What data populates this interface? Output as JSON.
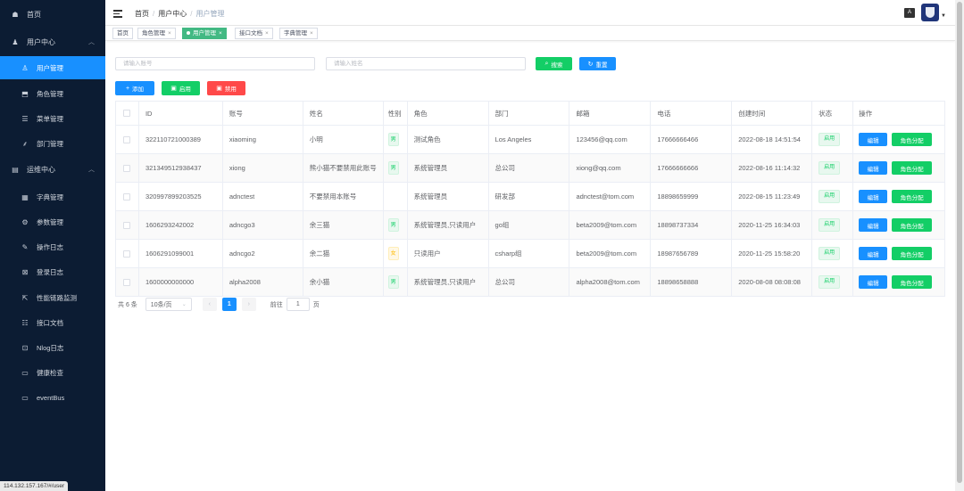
{
  "sidebar": {
    "items": [
      {
        "label": "首页",
        "icon": "dashboard-icon",
        "glyph": "☗"
      },
      {
        "label": "用户中心",
        "icon": "user-group-icon",
        "glyph": "♟"
      },
      {
        "label": "用户管理",
        "icon": "user-icon",
        "glyph": "♙"
      },
      {
        "label": "角色管理",
        "icon": "role-icon",
        "glyph": "⬒"
      },
      {
        "label": "菜单管理",
        "icon": "menu-list-icon",
        "glyph": "☰"
      },
      {
        "label": "部门管理",
        "icon": "tree-icon",
        "glyph": "⸙"
      },
      {
        "label": "运维中心",
        "icon": "ops-icon",
        "glyph": "▤"
      },
      {
        "label": "字典管理",
        "icon": "dict-icon",
        "glyph": "▦"
      },
      {
        "label": "参数管理",
        "icon": "param-icon",
        "glyph": "⚙"
      },
      {
        "label": "操作日志",
        "icon": "edit-log-icon",
        "glyph": "✎"
      },
      {
        "label": "登录日志",
        "icon": "login-log-icon",
        "glyph": "⊠"
      },
      {
        "label": "性能链路监测",
        "icon": "monitor-icon",
        "glyph": "⇱"
      },
      {
        "label": "接口文档",
        "icon": "api-doc-icon",
        "glyph": "☷"
      },
      {
        "label": "Nlog日志",
        "icon": "nlog-icon",
        "glyph": "⊡"
      },
      {
        "label": "健康检查",
        "icon": "health-icon",
        "glyph": "▭"
      },
      {
        "label": "eventBus",
        "icon": "eventbus-icon",
        "glyph": "▭"
      }
    ],
    "status_url": "114.132.157.167/#/user"
  },
  "header": {
    "breadcrumb": [
      "首页",
      "用户中心",
      "用户管理"
    ],
    "lang_label": "A"
  },
  "tags": [
    {
      "label": "首页"
    },
    {
      "label": "角色管理"
    },
    {
      "label": "用户管理"
    },
    {
      "label": "接口文档"
    },
    {
      "label": "字典管理"
    }
  ],
  "search": {
    "account_placeholder": "请输入账号",
    "name_placeholder": "请输入姓名",
    "search_label": "搜索",
    "reset_label": "重置"
  },
  "toolbar": {
    "add_label": "添加",
    "enable_label": "启用",
    "disable_label": "禁用"
  },
  "table": {
    "columns": [
      "ID",
      "账号",
      "姓名",
      "性别",
      "角色",
      "部门",
      "邮箱",
      "电话",
      "创建时间",
      "状态",
      "操作"
    ],
    "rows": [
      {
        "id": "322110721000389",
        "account": "xiaoming",
        "name": "小明",
        "sex": "男",
        "role": "测试角色",
        "dept": "Los Angeles",
        "email": "123456@qq.com",
        "phone": "17666666466",
        "created": "2022-08-18 14:51:54",
        "status": "启用"
      },
      {
        "id": "321349512938437",
        "account": "xiong",
        "name": "熊小猫不要禁用此账号",
        "sex": "男",
        "role": "系统管理员",
        "dept": "总公司",
        "email": "xiong@qq.com",
        "phone": "17666666666",
        "created": "2022-08-16 11:14:32",
        "status": "启用"
      },
      {
        "id": "320997899203525",
        "account": "adnctest",
        "name": "不要禁用本账号",
        "sex": "",
        "role": "系统管理员",
        "dept": "研发部",
        "email": "adnctest@tom.com",
        "phone": "18898659999",
        "created": "2022-08-15 11:23:49",
        "status": "启用"
      },
      {
        "id": "1606293242002",
        "account": "adncgo3",
        "name": "余三猫",
        "sex": "男",
        "role": "系统管理员,只读用户",
        "dept": "go组",
        "email": "beta2009@tom.com",
        "phone": "18898737334",
        "created": "2020-11-25 16:34:03",
        "status": "启用"
      },
      {
        "id": "1606291099001",
        "account": "adncgo2",
        "name": "余二猫",
        "sex": "女",
        "role": "只读用户",
        "dept": "csharp组",
        "email": "beta2009@tom.com",
        "phone": "18987656789",
        "created": "2020-11-25 15:58:20",
        "status": "启用"
      },
      {
        "id": "1600000000000",
        "account": "alpha2008",
        "name": "余小猫",
        "sex": "男",
        "role": "系统管理员,只读用户",
        "dept": "总公司",
        "email": "alpha2008@tom.com",
        "phone": "18898658888",
        "created": "2020-08-08 08:08:08",
        "status": "启用"
      }
    ],
    "edit_label": "编辑",
    "role_assign_label": "角色分配"
  },
  "pagination": {
    "total_text": "共 6 条",
    "page_size": "10条/页",
    "current_page": "1",
    "goto_label": "前往",
    "goto_value": "1",
    "page_unit": "页"
  }
}
